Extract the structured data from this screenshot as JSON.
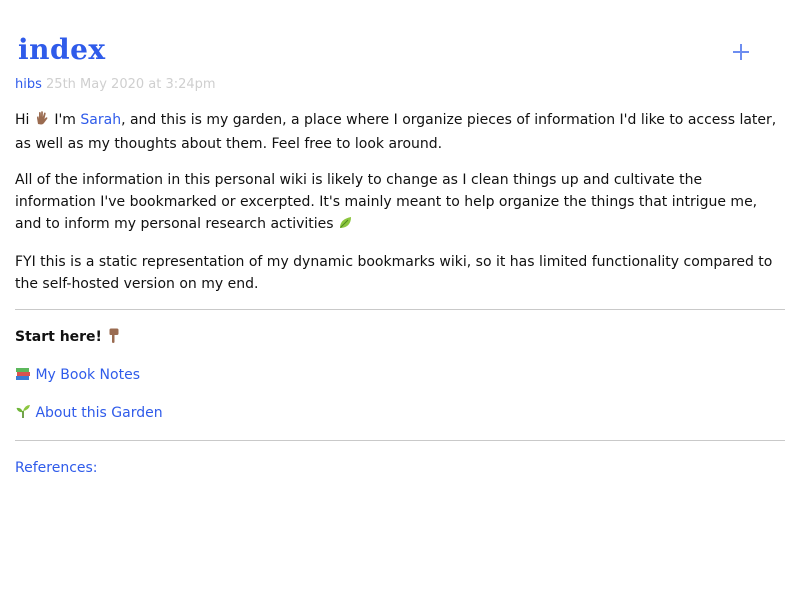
{
  "page": {
    "title": "index",
    "author": "hibs",
    "timestamp": "25th May 2020 at 3:24pm"
  },
  "intro": {
    "p1_start": "Hi ",
    "p1_mid": " I'm ",
    "name_link": "Sarah",
    "p1_end": ", and this is my garden, a place where I organize pieces of information I'd like to access later, as well as my thoughts about them. Feel free to look around.",
    "p2": "All of the information in this personal wiki is likely to change as I clean things up and cultivate the information I've bookmarked or excerpted. It's mainly meant to help organize the things that intrigue me, and to inform my personal research activities ",
    "p3": "FYI this is a static representation of my dynamic bookmarks wiki, so it has limited functionality compared to the self-hosted version on my end."
  },
  "start": {
    "label": "Start here! "
  },
  "nav": {
    "items": [
      {
        "label": "My Book Notes",
        "icon": "books-icon"
      },
      {
        "label": "About this Garden",
        "icon": "seedling-icon"
      }
    ]
  },
  "references": {
    "label": "References:"
  },
  "colors": {
    "accent": "#2f5bea",
    "meta_date": "#cfcfcf",
    "divider": "#c9c9c9",
    "text": "#111111"
  }
}
